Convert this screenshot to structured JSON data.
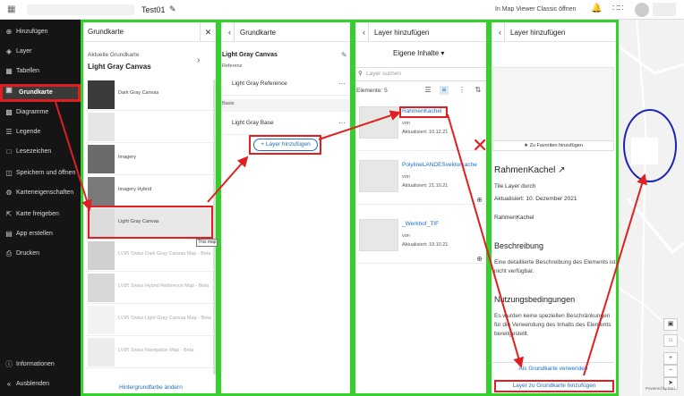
{
  "topbar": {
    "title": "Test01",
    "open_classic": "In Map Viewer Classic öffnen"
  },
  "nav": {
    "items": [
      {
        "label": "Hinzufügen",
        "icon": "plus-circle-icon"
      },
      {
        "label": "Layer",
        "icon": "layers-icon"
      },
      {
        "label": "Tabellen",
        "icon": "table-icon"
      },
      {
        "label": "Grundkarte",
        "icon": "basemap-icon",
        "active": true
      },
      {
        "label": "Diagramme",
        "icon": "chart-icon"
      },
      {
        "label": "Legende",
        "icon": "legend-icon"
      },
      {
        "label": "Lesezeichen",
        "icon": "bookmark-icon"
      },
      {
        "label": "Speichern und öffnen",
        "icon": "save-icon"
      },
      {
        "label": "Karteneigenschaften",
        "icon": "gear-icon"
      },
      {
        "label": "Karte freigeben",
        "icon": "share-icon"
      },
      {
        "label": "App erstellen",
        "icon": "app-icon"
      },
      {
        "label": "Drucken",
        "icon": "print-icon"
      }
    ],
    "info": "Informationen",
    "collapse": "Ausblenden"
  },
  "panel1": {
    "title": "Grundkarte",
    "current_label": "Aktuelle Grundkarte",
    "current_name": "Light Gray Canvas",
    "basemaps": [
      {
        "name": "Dark Gray Canvas",
        "color": "#3a3a3a"
      },
      {
        "name": "",
        "color": "#e6e6e6"
      },
      {
        "name": "Imagery",
        "color": "#6b6b6b"
      },
      {
        "name": "Imagery Hybrid",
        "color": "#7a7a7a"
      },
      {
        "name": "Light Gray Canvas",
        "color": "#dcdcdc"
      },
      {
        "name": "LV95 Swiss Dark Gray Canvas Map - Beta",
        "color": "#8a8a8a"
      },
      {
        "name": "LV95 Swiss Hybrid Reference Map - Beta",
        "color": "#9a9a9a"
      },
      {
        "name": "LV95 Swiss Light Gray Canvas Map - Beta",
        "color": "#dedede"
      },
      {
        "name": "LV95 Swiss Navigation Map - Beta",
        "color": "#d0d0d0"
      }
    ],
    "tooltip": "This map",
    "bg_color_link": "Hintergrundfarbe ändern"
  },
  "panel2": {
    "title": "Grundkarte",
    "basemap_title": "Light Gray Canvas",
    "reference_label": "Referenz",
    "reference_layer": "Light Gray Reference",
    "basis_label": "Basis",
    "basis_layer": "Light Gray Base",
    "add_button": "Layer hinzufügen"
  },
  "panel3": {
    "title": "Layer hinzufügen",
    "content_tab": "Eigene Inhalte",
    "search_placeholder": "Layer suchen",
    "count": "Elemente: 5",
    "items": [
      {
        "title": "RahmenKachel",
        "by": "von",
        "updated": "Aktualisiert: 10.12.21"
      },
      {
        "title": "PolylineLANDESvektorkache",
        "by": "von",
        "updated": "Aktualisiert: 21.10.21"
      },
      {
        "title": "_Werkhof_TIF",
        "by": "von",
        "updated": "Aktualisiert: 19.10.21"
      }
    ]
  },
  "panel4": {
    "title": "Layer hinzufügen",
    "favorite": "Zu Favoriten hinzufügen",
    "item_name": "RahmenKachel",
    "tile_layer": "Tile Layer durch",
    "updated": "Aktualisiert: 10. Dezember 2021",
    "item_label": "RahmenKachel",
    "desc_heading": "Beschreibung",
    "desc_text": "Eine detaillierte Beschreibung des Elements ist nicht verfügbar.",
    "terms_heading": "Nutzungsbedingungen",
    "terms_text": "Es wurden keine speziellen Beschränkungen für die Verwendung des Inhalts des Elements bereitgestellt.",
    "use_as_basemap": "Als Grundkarte verwenden",
    "add_to_basemap": "Layer zu Grundkarte hinzufügen"
  },
  "map": {
    "credit": "Powered by Esri"
  },
  "colors": {
    "highlight_green": "#34d02b",
    "annotation_red": "#e02020",
    "annotation_blue": "#1c24b8",
    "link_blue": "#1a6fc4"
  }
}
